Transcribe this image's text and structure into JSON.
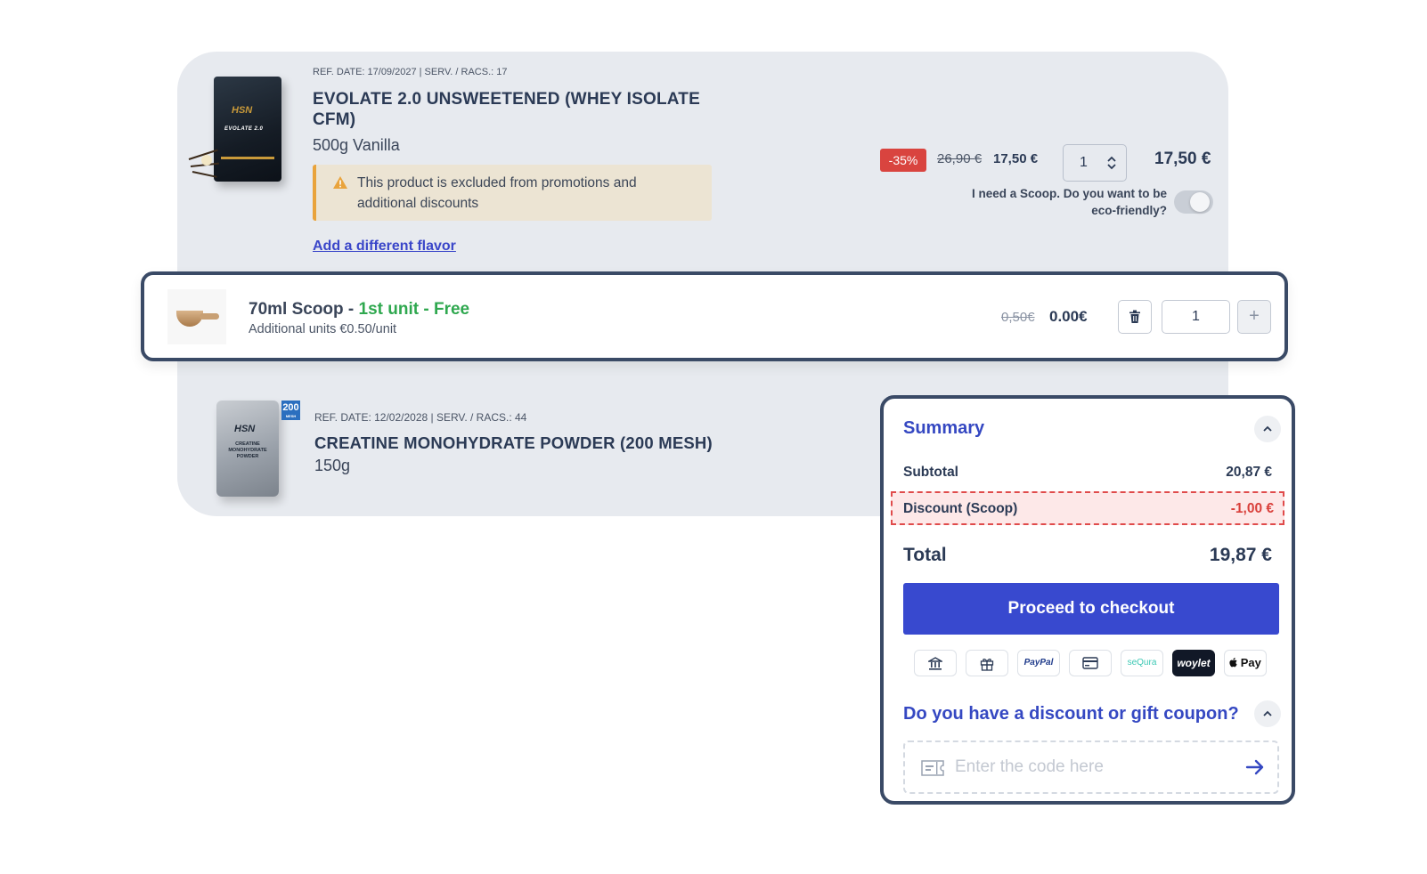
{
  "product1": {
    "ref": "REF. DATE: 17/09/2027 | SERV. / RACS.: 17",
    "title": "EVOLATE 2.0 UNSWEETENED (WHEY ISOLATE CFM)",
    "variant": "500g Vanilla",
    "pack_brand": "HSN",
    "pack_name": "EVOLATE 2.0",
    "warning": "This product is excluded from promotions and additional discounts",
    "flavor_link": "Add a different flavor",
    "discount_badge": "-35%",
    "old_price": "26,90 €",
    "new_price": "17,50 €",
    "quantity": "1",
    "line_total": "17,50 €",
    "scoop_question": "I need a Scoop. Do you want to be eco-friendly?"
  },
  "scoop": {
    "name": "70ml Scoop - ",
    "free_label": "1st unit - Free",
    "sub": "Additional units €0.50/unit",
    "old_price": "0,50€",
    "new_price": "0.00€",
    "quantity": "1",
    "plus": "+"
  },
  "product2": {
    "ref": "REF. DATE: 12/02/2028 | SERV. / RACS.: 44",
    "title": "CREATINE MONOHYDRATE POWDER (200 MESH)",
    "variant": "150g",
    "bag_brand": "HSN",
    "bag_name": "CREATINE MONOHYDRATE POWDER",
    "mesh_badge": "200",
    "mesh_small": "MESH"
  },
  "summary": {
    "title": "Summary",
    "subtotal_label": "Subtotal",
    "subtotal_value": "20,87 €",
    "discount_label": "Discount (Scoop)",
    "discount_value": "-1,00 €",
    "total_label": "Total",
    "total_value": "19,87 €",
    "checkout_label": "Proceed to checkout",
    "payments": {
      "paypal": "PayPal",
      "sequra": "seQura",
      "woylet": "woylet",
      "apple": " Pay"
    },
    "coupon_title": "Do you have a discount or gift coupon?",
    "coupon_placeholder": "Enter the code here"
  },
  "colors": {
    "accent": "#3849cf",
    "discount_red": "#d9443f",
    "free_green": "#2fa84f",
    "warning_amber": "#e9a33b"
  },
  "icons": [
    "warning-icon",
    "chevron-updown-icon",
    "trash-icon",
    "plus-icon",
    "chevron-up-icon",
    "bank-icon",
    "gift-icon",
    "card-icon",
    "apple-icon",
    "ticket-icon",
    "arrow-right-icon"
  ]
}
